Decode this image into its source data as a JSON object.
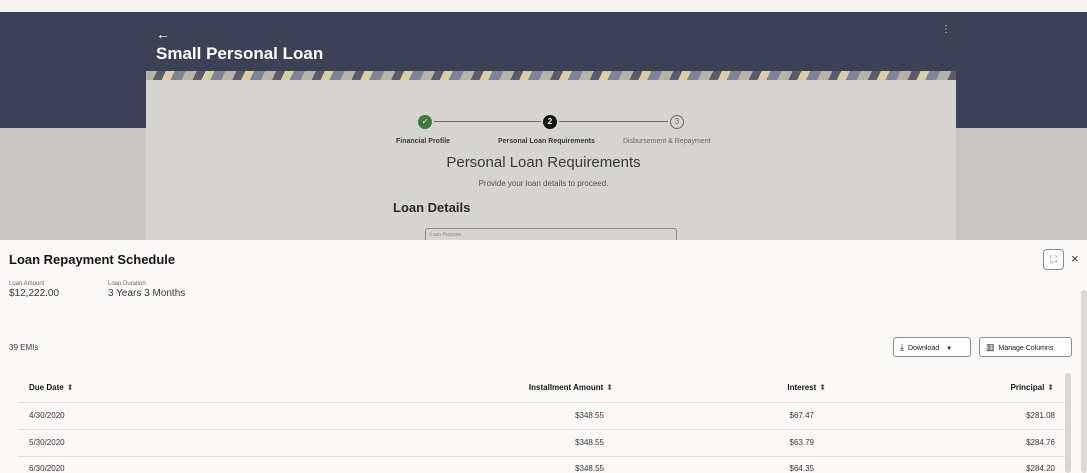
{
  "header": {
    "back_icon": "←",
    "title": "Small Personal Loan",
    "menu_icon": "⋮"
  },
  "stepper": {
    "steps": [
      {
        "label": "Financial Profile",
        "marker": "✓"
      },
      {
        "label": "Personal Loan Requirements",
        "marker": "2"
      },
      {
        "label": "Disbursement & Repayment",
        "marker": "3"
      }
    ]
  },
  "form": {
    "heading": "Personal Loan Requirements",
    "subheading": "Provide your loan details to proceed.",
    "section_title": "Loan Details",
    "field_label": "Loan Purpose"
  },
  "drawer": {
    "title": "Loan Repayment Schedule",
    "expand_icon": "⛶",
    "close_icon": "×",
    "summary": [
      {
        "label": "Loan Amount",
        "value": "$12,222.00"
      },
      {
        "label": "Loan Duration",
        "value": "3 Years 3 Months"
      }
    ],
    "emi_count": "39 EMIs",
    "download_label": "Download",
    "manage_columns_label": "Manage Columns",
    "columns": [
      "Due Date",
      "Installment Amount",
      "Interest",
      "Principal"
    ],
    "sort_icon": "⬍",
    "rows": [
      [
        "4/30/2020",
        "$348.55",
        "$67.47",
        "$281.08"
      ],
      [
        "5/30/2020",
        "$348.55",
        "$63.79",
        "$284.76"
      ],
      [
        "6/30/2020",
        "$348.55",
        "$64.35",
        "$284.20"
      ]
    ]
  },
  "colors": {
    "header_bg": "#3d4155",
    "success": "#3f7a3a",
    "drawer_bg": "#fbf9f8"
  }
}
